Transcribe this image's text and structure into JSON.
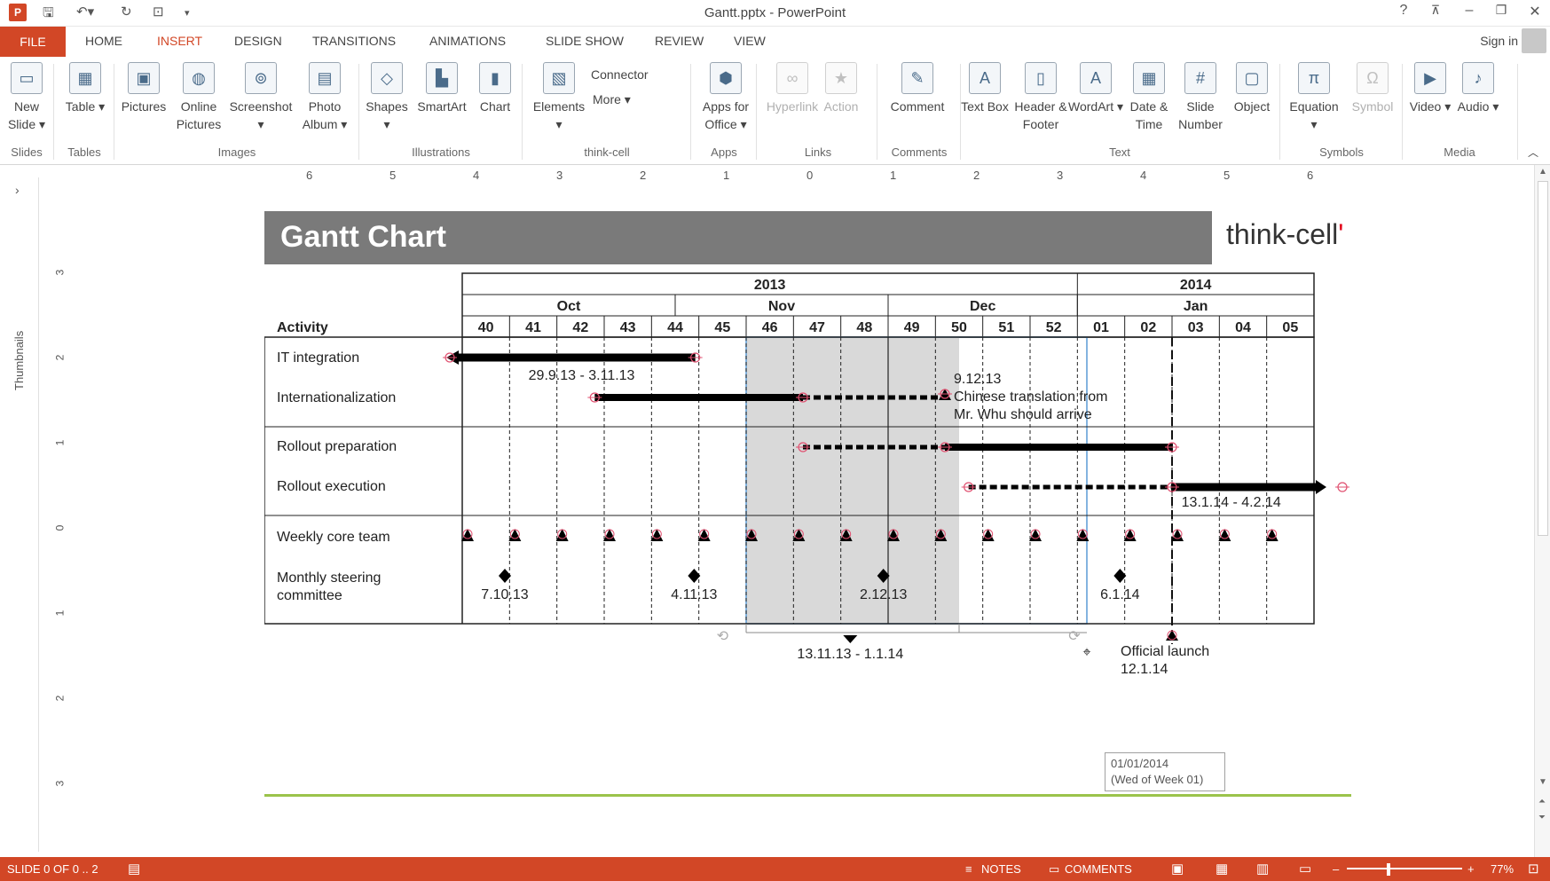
{
  "window": {
    "title": "Gantt.pptx - PowerPoint",
    "app_icon": "P",
    "help": "?",
    "controls": [
      "restore-ribbon",
      "minimize",
      "restore",
      "close"
    ]
  },
  "tabs": [
    "FILE",
    "HOME",
    "INSERT",
    "DESIGN",
    "TRANSITIONS",
    "ANIMATIONS",
    "SLIDE SHOW",
    "REVIEW",
    "VIEW"
  ],
  "active_tab": "INSERT",
  "signin": "Sign in",
  "ribbon": {
    "buttons": [
      {
        "name": "new-slide-button",
        "label": "New Slide ▾",
        "icon": "new-slide-icon",
        "glyph": "▭"
      },
      {
        "name": "table-button",
        "label": "Table ▾",
        "icon": "table-icon",
        "glyph": "▦"
      },
      {
        "name": "pictures-button",
        "label": "Pictures",
        "icon": "pictures-icon",
        "glyph": "▣"
      },
      {
        "name": "online-pictures-button",
        "label": "Online Pictures",
        "icon": "online-pictures-icon",
        "glyph": "◍"
      },
      {
        "name": "screenshot-button",
        "label": "Screenshot ▾",
        "icon": "camera-icon",
        "glyph": "⊚"
      },
      {
        "name": "photo-album-button",
        "label": "Photo Album ▾",
        "icon": "photo-album-icon",
        "glyph": "▤"
      },
      {
        "name": "shapes-button",
        "label": "Shapes ▾",
        "icon": "shapes-icon",
        "glyph": "◇"
      },
      {
        "name": "smartart-button",
        "label": "SmartArt",
        "icon": "smartart-icon",
        "glyph": "▙"
      },
      {
        "name": "chart-button",
        "label": "Chart",
        "icon": "chart-icon",
        "glyph": "▮"
      },
      {
        "name": "elements-button",
        "label": "Elements ▾",
        "icon": "elements-icon",
        "glyph": "▧"
      },
      {
        "name": "apps-for-office-button",
        "label": "Apps for Office ▾",
        "icon": "apps-icon",
        "glyph": "⬢"
      },
      {
        "name": "hyperlink-button",
        "label": "Hyperlink",
        "icon": "hyperlink-icon",
        "glyph": "∞",
        "disabled": true
      },
      {
        "name": "action-button",
        "label": "Action",
        "icon": "action-icon",
        "glyph": "★",
        "disabled": true
      },
      {
        "name": "comment-button",
        "label": "Comment",
        "icon": "comment-icon",
        "glyph": "✎"
      },
      {
        "name": "text-box-button",
        "label": "Text Box",
        "icon": "text-box-icon",
        "glyph": "A"
      },
      {
        "name": "header-footer-button",
        "label": "Header & Footer",
        "icon": "header-footer-icon",
        "glyph": "▯"
      },
      {
        "name": "wordart-button",
        "label": "WordArt ▾",
        "icon": "wordart-icon",
        "glyph": "A"
      },
      {
        "name": "date-time-button",
        "label": "Date & Time",
        "icon": "calendar-icon",
        "glyph": "▦"
      },
      {
        "name": "slide-number-button",
        "label": "Slide Number",
        "icon": "slide-number-icon",
        "glyph": "#"
      },
      {
        "name": "object-button",
        "label": "Object",
        "icon": "object-icon",
        "glyph": "▢"
      },
      {
        "name": "equation-button",
        "label": "Equation ▾",
        "icon": "pi-icon",
        "glyph": "π"
      },
      {
        "name": "symbol-button",
        "label": "Symbol",
        "icon": "omega-icon",
        "glyph": "Ω",
        "disabled": true
      },
      {
        "name": "video-button",
        "label": "Video ▾",
        "icon": "video-icon",
        "glyph": "▶"
      },
      {
        "name": "audio-button",
        "label": "Audio ▾",
        "icon": "audio-icon",
        "glyph": "♪"
      }
    ],
    "small_buttons": {
      "connector": "Connector",
      "more": "More ▾"
    },
    "groups": [
      "Slides",
      "Tables",
      "Images",
      "Illustrations",
      "think-cell",
      "Apps",
      "Links",
      "Comments",
      "Text",
      "Symbols",
      "Media"
    ]
  },
  "ruler": {
    "marks": [
      "6",
      "5",
      "4",
      "3",
      "2",
      "1",
      "0",
      "1",
      "2",
      "3",
      "4",
      "5",
      "6"
    ],
    "vmarks": [
      "3",
      "2",
      "1",
      "0",
      "1",
      "2",
      "3"
    ]
  },
  "thumbnails_label": "Thumbnails",
  "slide": {
    "title": "Gantt Chart",
    "brand": "think-cell",
    "gantt": {
      "years": [
        {
          "label": "2013"
        },
        {
          "label": "2014"
        }
      ],
      "months": [
        "Oct",
        "Nov",
        "Dec",
        "Jan"
      ],
      "weeks": [
        "40",
        "41",
        "42",
        "43",
        "44",
        "45",
        "46",
        "47",
        "48",
        "49",
        "50",
        "51",
        "52",
        "01",
        "02",
        "03",
        "04",
        "05"
      ],
      "activity_header": "Activity",
      "activities": [
        "IT integration",
        "Internationalization",
        "Rollout preparation",
        "Rollout execution",
        "Weekly core team",
        "Monthly steering committee"
      ],
      "labels": {
        "it_integration": "29.9.13 - 3.11.13",
        "milestone_date": "9.12.13",
        "milestone_note_1": "Chinese translation from",
        "milestone_note_2": "Mr. Whu should arrive",
        "rollout_exec": "13.1.14 - 4.2.14",
        "steering_1": "7.10.13",
        "steering_2": "4.11.13",
        "steering_3": "2.12.13",
        "steering_4": "6.1.14",
        "shade_range": "13.11.13 - 1.1.14",
        "launch": "Official launch",
        "launch_date": "12.1.14"
      }
    }
  },
  "tooltip": {
    "line1": "01/01/2014",
    "line2": "(Wed of Week 01)"
  },
  "status": {
    "slide": "SLIDE 0 OF 0 .. 2",
    "notes": "NOTES",
    "comments": "COMMENTS",
    "zoom": "77%"
  }
}
